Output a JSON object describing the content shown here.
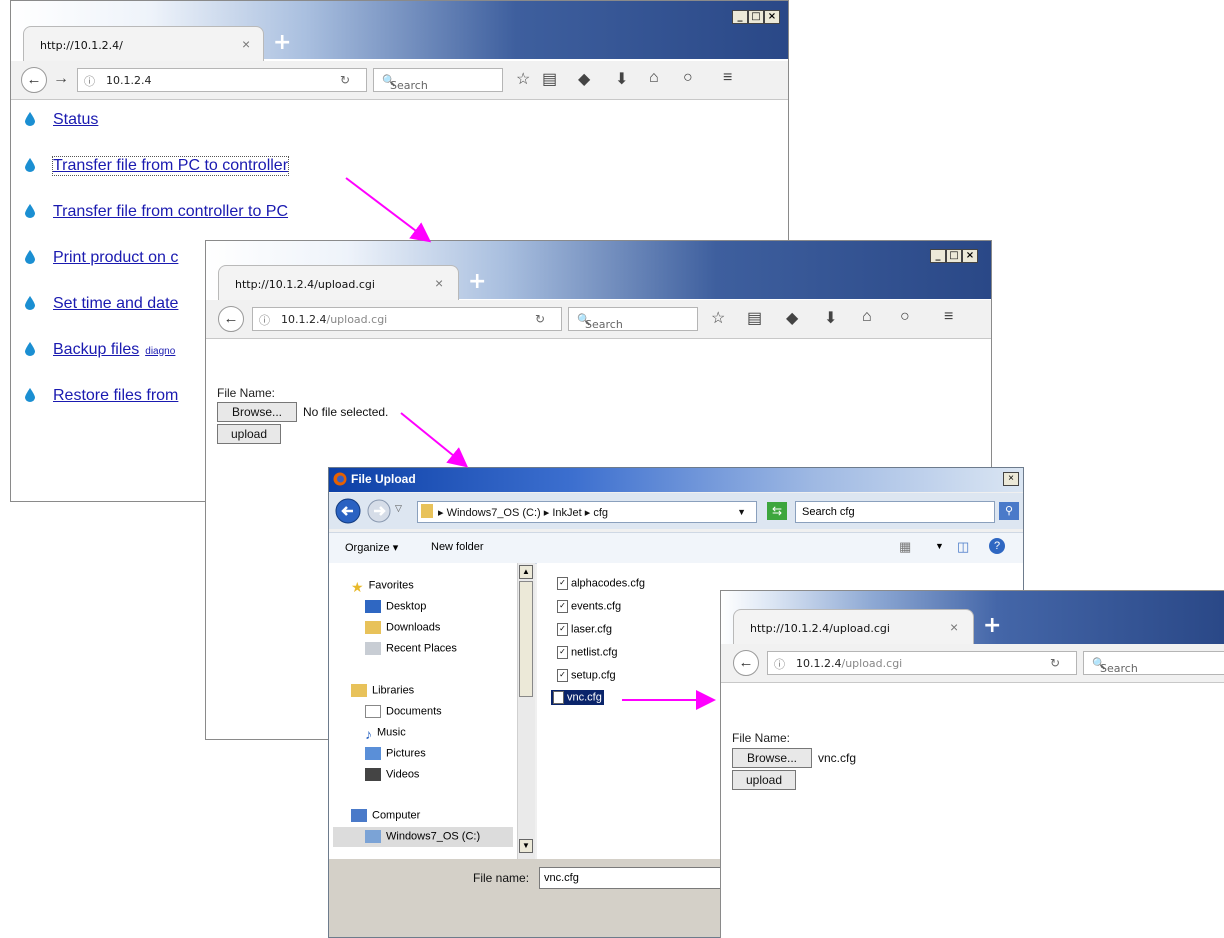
{
  "win1": {
    "tab_title": "http://10.1.2.4/",
    "tab_close": "×",
    "newtab": "+",
    "url_host": "10.1.2.4",
    "url_path": "",
    "search_placeholder": "Search",
    "links": [
      {
        "label": "Status",
        "suffix": ""
      },
      {
        "label": "Transfer file from PC to controller",
        "suffix": ""
      },
      {
        "label": "Transfer file from controller to PC",
        "suffix": ""
      },
      {
        "label": "Print product on c",
        "suffix": ""
      },
      {
        "label": "Set time and date",
        "suffix": ""
      },
      {
        "label": "Backup files",
        "suffix": "diagno"
      },
      {
        "label": "Restore files from",
        "suffix": ""
      }
    ]
  },
  "win2": {
    "tab_title": "http://10.1.2.4/upload.cgi",
    "tab_close": "×",
    "newtab": "+",
    "url_host": "10.1.2.4",
    "url_path": "/upload.cgi",
    "search_placeholder": "Search",
    "file_name_label": "File Name:",
    "browse_label": "Browse...",
    "file_status": "No file selected.",
    "upload_label": "upload"
  },
  "dialog": {
    "title": "File Upload",
    "path": "▸ Windows7_OS (C:) ▸ InkJet ▸ cfg",
    "search_placeholder": "Search cfg",
    "organize_label": "Organize ▾",
    "new_folder_label": "New folder",
    "nav": {
      "favorites": "Favorites",
      "desktop": "Desktop",
      "downloads": "Downloads",
      "recent_places": "Recent Places",
      "libraries": "Libraries",
      "documents": "Documents",
      "music": "Music",
      "pictures": "Pictures",
      "videos": "Videos",
      "computer": "Computer",
      "drive": "Windows7_OS (C:)"
    },
    "files": [
      "alphacodes.cfg",
      "events.cfg",
      "laser.cfg",
      "netlist.cfg",
      "setup.cfg",
      "vnc.cfg"
    ],
    "file_name_label": "File name:",
    "file_name_value": "vnc.cfg"
  },
  "win3": {
    "tab_title": "http://10.1.2.4/upload.cgi",
    "tab_close": "×",
    "newtab": "+",
    "url_host": "10.1.2.4",
    "url_path": "/upload.cgi",
    "search_placeholder": "Search",
    "file_name_label": "File Name:",
    "browse_label": "Browse...",
    "file_status": "vnc.cfg",
    "upload_label": "upload"
  },
  "colors": {
    "link": "#1a1ab0",
    "arrow": "#ff00ff",
    "selection": "#0a246a"
  }
}
